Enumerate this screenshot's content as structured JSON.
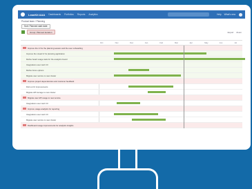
{
  "app": {
    "name": "LeanKit AAA",
    "nav": [
      "Dashboards",
      "Portfolios",
      "Reports",
      "Analytics"
    ],
    "right": [
      "Help",
      "What's new"
    ]
  },
  "breadcrumb": "Product team / Planning",
  "filter_chip": "Sort: Planned start date",
  "group_pill": "Group: Planned iteration",
  "controls": [
    "Export",
    "Zoom"
  ],
  "timeline_headers": [
    "Oct",
    "Nov",
    "Dec",
    "Jan",
    "Feb",
    "Mar",
    "Apr",
    "May",
    "Jun",
    "Jul"
  ],
  "rows": [
    {
      "label": "Improve the UI for the planning session and the user onboarding",
      "group": true
    },
    {
      "label": "Improve the visual UI for planning application",
      "group": false
    },
    {
      "label": "Refine board usage stats for the analytics board",
      "group": false
    },
    {
      "label": "Integrations user card 3.0",
      "group": false
    },
    {
      "label": "Refine focus options",
      "group": false
    },
    {
      "label": "Migrate user service to new cluster",
      "group": false
    },
    {
      "label": "Improve project dependencies and customer feedback",
      "group": true
    },
    {
      "label": "Roll out UI improvements",
      "group": false
    },
    {
      "label": "Migrate API storage to new cluster",
      "group": false
    },
    {
      "label": "Migrate user API usage to new service",
      "group": true
    },
    {
      "label": "Integrations user card 3.0",
      "group": false
    },
    {
      "label": "Improve usage analytics for reporting",
      "group": true
    },
    {
      "label": "Integrations user card 3.0",
      "group": false
    },
    {
      "label": "Migrate user service to new cluster",
      "group": false
    },
    {
      "label": "Dashboard usage improvements for analytics insights",
      "group": true
    }
  ],
  "bars": [
    {
      "row": 1,
      "start": 0.1,
      "end": 0.72
    },
    {
      "row": 2,
      "start": 0.1,
      "end": 1.0
    },
    {
      "row": 4,
      "start": 0.2,
      "end": 0.34
    },
    {
      "row": 5,
      "start": 0.1,
      "end": 0.55
    },
    {
      "row": 7,
      "start": 0.2,
      "end": 0.5
    },
    {
      "row": 8,
      "start": 0.33,
      "end": 0.45
    },
    {
      "row": 10,
      "start": 0.12,
      "end": 0.28
    },
    {
      "row": 12,
      "start": 0.1,
      "end": 0.4
    },
    {
      "row": 13,
      "start": 0.22,
      "end": 0.45
    }
  ],
  "colors": {
    "accent": "#2e6fb7",
    "bar": "#7fb24c",
    "group_row": "#fbeaea",
    "background": "#136aa8"
  }
}
